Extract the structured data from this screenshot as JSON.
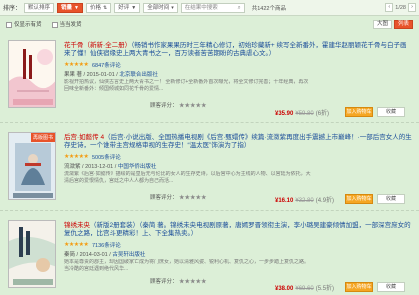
{
  "toolbar": {
    "sort_label": "排序：",
    "default_sort": "默认排序",
    "sales": "销量",
    "price": "价格",
    "rating": "好评",
    "publish_time": "全部时间",
    "search_placeholder": "在结果中搜索",
    "result_count": "共1422个商品",
    "page": "1/28",
    "prev": "‹",
    "next": "›"
  },
  "filter": {
    "only_stock": "仅显示有货",
    "only_dangdang": "当当发货",
    "view_large": "大图",
    "view_list": "列表"
  },
  "items": [
    {
      "title_prefix": "花千骨（新新·全二册）",
      "title_rest": "（畅销书作家果果历时三年精心修订，初始珍藏新+ 续写全新番外，霍建华赵丽颖花千骨与白子画来了懂！仙侠宿缘史上两大青书之一，百万读者苦苦期盼的古典虐心文。）",
      "stars": "★★★★★",
      "reviews": "6847条评论",
      "author": "果果 著",
      "date": "2015-01-01",
      "publisher": "北京联合出版社",
      "desc": "影视开拍热议，仙侠古言史上两大青书之一！ 全新修订+全新番外首次曝光，将全文修订完善；十年经典，再次回味全新番外：倾国倾城如同花千骨的爱情...",
      "rating_label": "顾客评分：",
      "rating_stars": "★★★★★",
      "price": "¥35.90",
      "orig_price": "¥59.80",
      "discount": "(6折)",
      "cart": "加入购物车",
      "fav": "收藏"
    },
    {
      "title_prefix": "后宫·如懿传 4",
      "title_rest": "（后宫·小说出版、全国热播电视剧《后宫·甄嬛传》续篇·流潋紫再度出手震撼上市巅峰！·一部后宫女人的生存史诗，一个谁带主宫规格审视的生存史！“温太医”饰演为了指）",
      "stars": "★★★★★",
      "reviews": "5005条评论",
      "author": "流潋紫",
      "date": "2013-12-01",
      "publisher": "中国华侨出版社",
      "desc": "流潋紫《后宫·如懿传》描绘的是皇后无与伦比的女人的生存史诗，以后宫中心为主线的人物、以宫廷为依托，大清后宫的爱恨情仇，宫廷之中人人都为自己而活...",
      "rating_label": "顾客评分：",
      "rating_stars": "★★★★★",
      "price": "¥16.10",
      "orig_price": "¥32.80",
      "discount": "(4.9折)",
      "cart": "加入购物车",
      "fav": "收藏",
      "tag": "再版图书"
    },
    {
      "title_prefix": "锦绣未央",
      "title_rest": "（新版2册套装）（秦简 著。锦绣未央电视剧原著，唐嫣罗晋领衔主演，李小璐吴建豪倾情加盟，一部深宫庶女的复仇之路，比宫斗更精彩！上、下全集热卖。）",
      "stars": "★★★★★",
      "reviews": "7136条评论",
      "author": "秦简",
      "date": "2014-03-01",
      "publisher": "古吴轩出版社",
      "desc": "她本是尊贵的郡主，却因国破家亡成为将门庶女，她以清雅风姿、锐利心机、复仇之心，一步步踏上复仇之路。当冷酷的宫廷遇到绝代风华...",
      "rating_label": "顾客评分：",
      "rating_stars": "★★★★★",
      "price": "¥38.00",
      "orig_price": "¥69.60",
      "discount": "(5.5折)",
      "cart": "加入购物车",
      "fav": "收藏"
    }
  ],
  "colors": {
    "accent": "#e8532a",
    "link": "#1a4d99",
    "price": "#cc0000",
    "background": "#dcefd7"
  }
}
